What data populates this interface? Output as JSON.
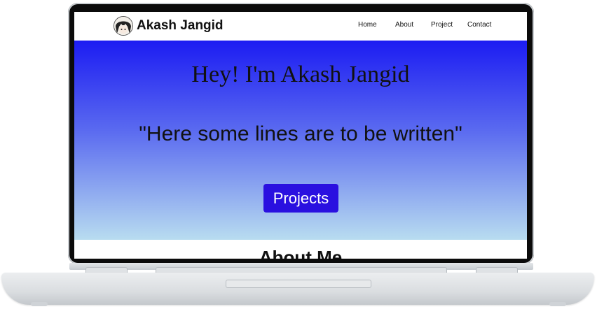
{
  "nav": {
    "brand": "Akash Jangid",
    "links": [
      "Home",
      "About",
      "Project",
      "Contact"
    ]
  },
  "hero": {
    "title": "Hey! I'm Akash Jangid",
    "quote": "\"Here some lines are to be written\"",
    "button_label": "Projects"
  },
  "about": {
    "title": "About Me"
  },
  "colors": {
    "hero_top": "#1c1cf2",
    "hero_bottom": "#b8dcf0",
    "button": "#2a10e0"
  },
  "icons": {
    "logo": "avatar-icon"
  }
}
